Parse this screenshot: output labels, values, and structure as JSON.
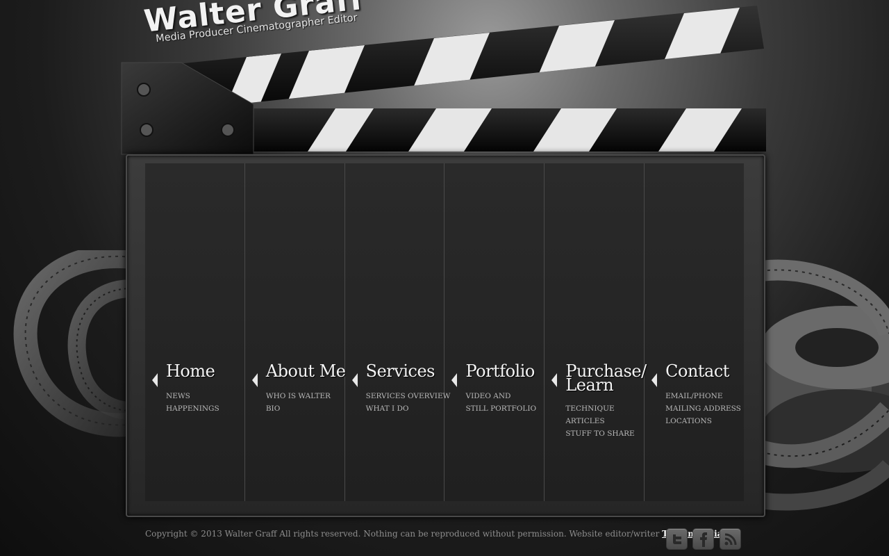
{
  "logo": {
    "title": "Walter Graff",
    "subtitle": "Media Producer Cinematographer Editor"
  },
  "nav": [
    {
      "label_lines": [
        "Home"
      ],
      "items": [
        "NEWS",
        "HAPPENINGS"
      ]
    },
    {
      "label_lines": [
        "About Me"
      ],
      "items": [
        "WHO IS WALTER",
        "BIO"
      ]
    },
    {
      "label_lines": [
        "Services"
      ],
      "items": [
        "SERVICES OVERVIEW",
        "WHAT I DO"
      ]
    },
    {
      "label_lines": [
        "Portfolio"
      ],
      "items": [
        "VIDEO AND",
        "STILL PORTFOLIO"
      ]
    },
    {
      "label_lines": [
        "Purchase/",
        "Learn"
      ],
      "items": [
        "TECHNIQUE",
        "ARTICLES",
        "STUFF TO SHARE"
      ]
    },
    {
      "label_lines": [
        "Contact"
      ],
      "items": [
        "EMAIL/PHONE",
        "MAILING ADDRESS",
        "LOCATIONS"
      ]
    }
  ],
  "footer": {
    "copyright": "Copyright © 2013 Walter Graff All rights reserved. Nothing can be reproduced without permission. Website editor/writer",
    "editor_link": "Tiegen Kosiak"
  },
  "social": {
    "twitter_icon": "twitter-icon",
    "facebook_icon": "facebook-icon",
    "rss_icon": "rss-icon"
  }
}
